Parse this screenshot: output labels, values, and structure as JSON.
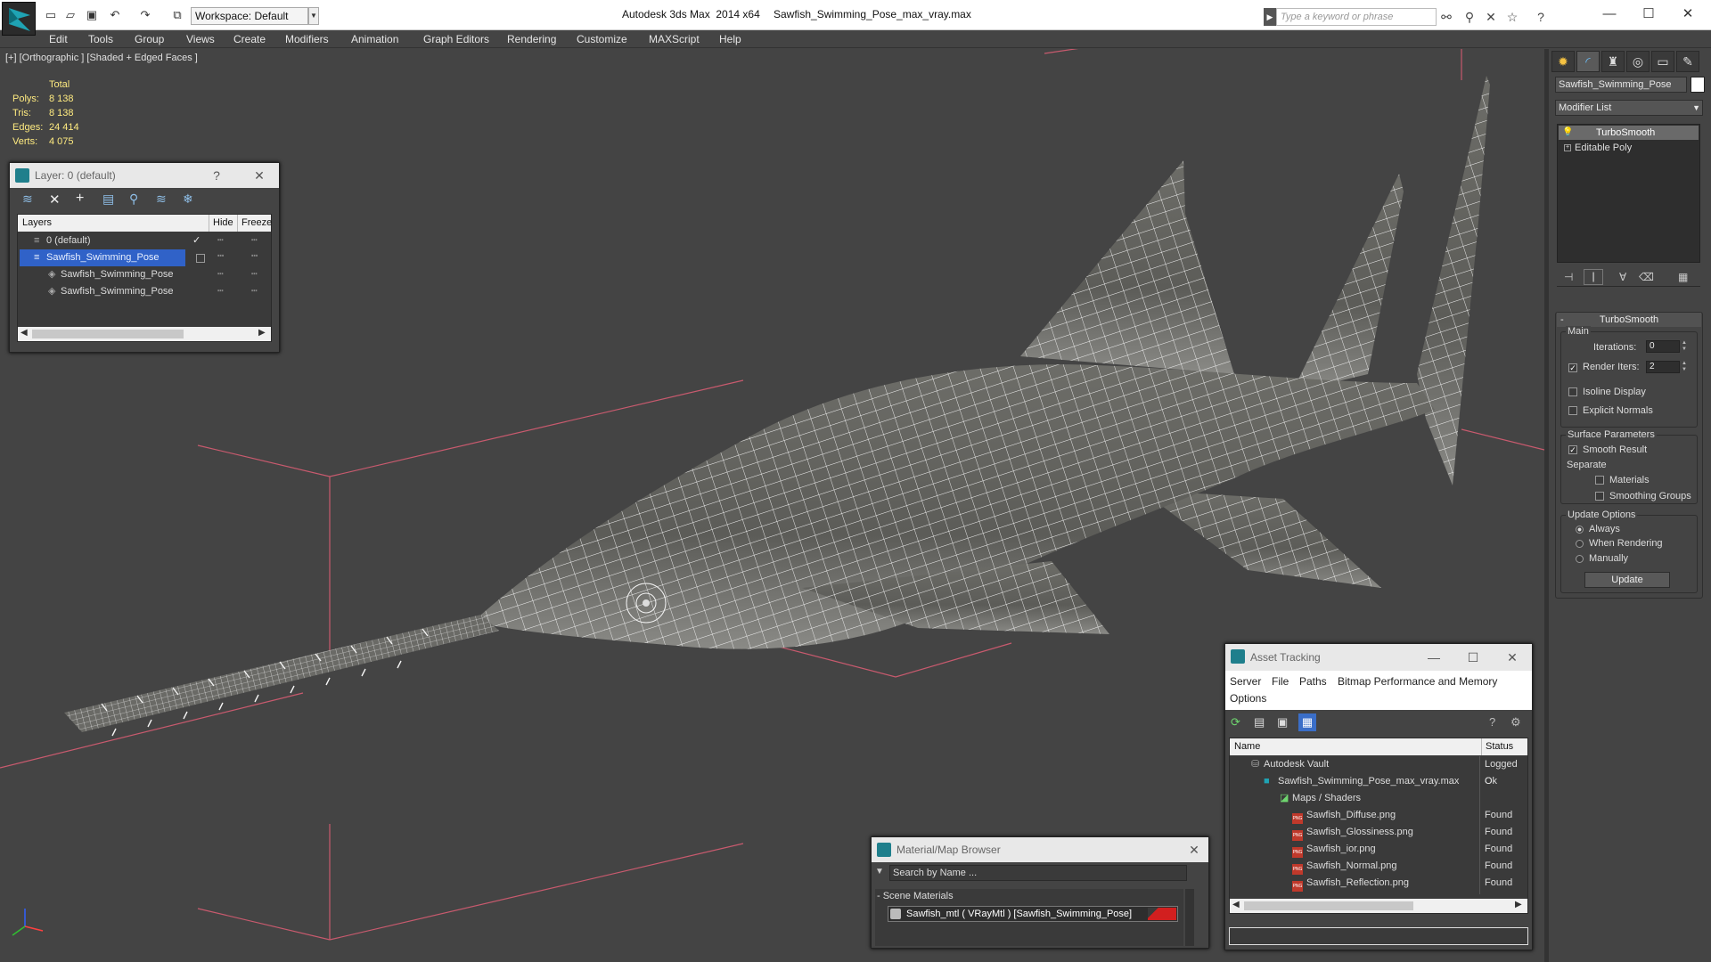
{
  "titlebar": {
    "app_title": "Autodesk 3ds Max  2014 x64",
    "file_title": "Sawfish_Swimming_Pose_max_vray.max",
    "workspace": "Workspace: Default",
    "search_placeholder": "Type a keyword or phrase"
  },
  "menu": [
    "Edit",
    "Tools",
    "Group",
    "Views",
    "Create",
    "Modifiers",
    "Animation",
    "Graph Editors",
    "Rendering",
    "Customize",
    "MAXScript",
    "Help"
  ],
  "viewport": {
    "label": "[+] [Orthographic ] [Shaded + Edged Faces ]",
    "stats": {
      "header": "Total",
      "rows": [
        {
          "label": "Polys:",
          "value": "8 138"
        },
        {
          "label": "Tris:",
          "value": "8 138"
        },
        {
          "label": "Edges:",
          "value": "24 414"
        },
        {
          "label": "Verts:",
          "value": "4 075"
        }
      ]
    }
  },
  "layer_panel": {
    "title": "Layer: 0 (default)",
    "help": "?",
    "columns": {
      "layers": "Layers",
      "hide": "Hide",
      "freeze": "Freeze"
    },
    "rows": [
      {
        "name": "0 (default)",
        "marker": "✓"
      },
      {
        "name": "Sawfish_Swimming_Pose"
      },
      {
        "name": "Sawfish_Swimming_Pose"
      },
      {
        "name": "Sawfish_Swimming_Pose"
      }
    ]
  },
  "command_panel": {
    "object_name": "Sawfish_Swimming_Pose",
    "modifier_list": "Modifier List",
    "stack": [
      "TurboSmooth",
      "Editable Poly"
    ],
    "rollout_title": "TurboSmooth",
    "main": "Main",
    "iterations_label": "Iterations:",
    "iterations": "0",
    "render_iters_label": "Render Iters:",
    "render_iters": "2",
    "isoline": "Isoline Display",
    "explicit_normals": "Explicit Normals",
    "surface_params": "Surface Parameters",
    "smooth_result": "Smooth Result",
    "separate": "Separate",
    "materials": "Materials",
    "smoothing_groups": "Smoothing Groups",
    "update_options": "Update Options",
    "always": "Always",
    "when_rendering": "When Rendering",
    "manually": "Manually",
    "update_button": "Update"
  },
  "asset_tracking": {
    "title": "Asset Tracking",
    "menu": [
      "Server",
      "File",
      "Paths",
      "Bitmap Performance and Memory",
      "Options"
    ],
    "col_name": "Name",
    "col_status": "Status",
    "rows": [
      {
        "name": "Autodesk Vault",
        "status": "Logged O"
      },
      {
        "name": "Sawfish_Swimming_Pose_max_vray.max",
        "status": "Ok"
      },
      {
        "name": "Maps / Shaders",
        "status": ""
      },
      {
        "name": "Sawfish_Diffuse.png",
        "status": "Found"
      },
      {
        "name": "Sawfish_Glossiness.png",
        "status": "Found"
      },
      {
        "name": "Sawfish_ior.png",
        "status": "Found"
      },
      {
        "name": "Sawfish_Normal.png",
        "status": "Found"
      },
      {
        "name": "Sawfish_Reflection.png",
        "status": "Found"
      }
    ]
  },
  "material_browser": {
    "title": "Material/Map Browser",
    "search_placeholder": "Search by Name ...",
    "section": "- Scene Materials",
    "material": "Sawfish_mtl  ( VRayMtl )  [Sawfish_Swimming_Pose]"
  },
  "colors": {
    "accent": "#1f7f8c",
    "selection": "#3062c8",
    "stats": "#ffeb80",
    "grid_lines": "#c85a6e"
  }
}
